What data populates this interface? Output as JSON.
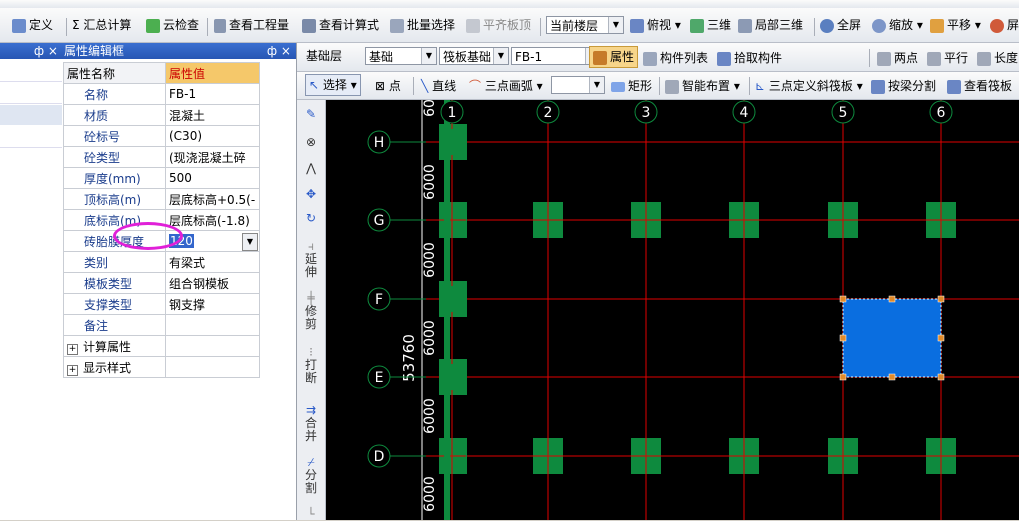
{
  "top_toolbar": {
    "items": [
      "定义",
      "Σ 汇总计算",
      "云检查",
      "查看工程量",
      "查看计算式",
      "批量选择",
      "平齐板顶"
    ],
    "floor_select": "当前楼层",
    "view_items": [
      "俯视",
      "三维",
      "局部三维",
      "全屏",
      "缩放",
      "平移",
      "屏"
    ]
  },
  "left_panel": {
    "close_glyph": "ф ×"
  },
  "props_panel": {
    "title": "属性编辑框",
    "title_buttons": "ф ×",
    "header": {
      "name": "属性名称",
      "value": "属性值"
    },
    "rows": [
      {
        "name": "名称",
        "value": "FB-1"
      },
      {
        "name": "材质",
        "value": "混凝土"
      },
      {
        "name": "砼标号",
        "value": "(C30)"
      },
      {
        "name": "砼类型",
        "value": "(现浇混凝土碎"
      },
      {
        "name": "厚度(mm)",
        "value": "500"
      },
      {
        "name": "顶标高(m)",
        "value": "层底标高+0.5(-"
      },
      {
        "name": "底标高(m)",
        "value": "层底标高(-1.8)"
      },
      {
        "name": "砖胎膜厚度",
        "value": "120"
      },
      {
        "name": "类别",
        "value": "有梁式"
      },
      {
        "name": "模板类型",
        "value": "组合钢模板"
      },
      {
        "name": "支撑类型",
        "value": "钢支撑"
      },
      {
        "name": "备注",
        "value": ""
      }
    ],
    "groups": [
      "计算属性",
      "显示样式"
    ]
  },
  "layer_bar": {
    "layer1": "基础层",
    "layer2": "基础",
    "type": "筏板基础",
    "component": "FB-1",
    "attr_button": "属性",
    "list_button": "构件列表",
    "pick_button": "拾取构件",
    "right_items": [
      "两点",
      "平行",
      "长度"
    ]
  },
  "draw_bar": {
    "select": "选择",
    "point": "点",
    "line": "直线",
    "arc": "三点画弧",
    "rect": "矩形",
    "smart": "智能布置",
    "slope": "三点定义斜筏板",
    "split": "按梁分割",
    "view_reinf": "查看筏板"
  },
  "vertical_tools": [
    "延伸",
    "修剪",
    "打断",
    "合并",
    "分割"
  ],
  "canvas": {
    "col_axes": [
      "1",
      "2",
      "3",
      "4",
      "5",
      "6"
    ],
    "row_axes": [
      "H",
      "G",
      "F",
      "E",
      "D"
    ],
    "dimensions": [
      "60",
      "6000",
      "6000",
      "6000",
      "6000",
      "6000"
    ],
    "total_dim": "53760",
    "colors": {
      "grid": "#e00000",
      "column": "#0e8a3e",
      "slab": "#0a6ee0",
      "background": "#000000"
    }
  }
}
